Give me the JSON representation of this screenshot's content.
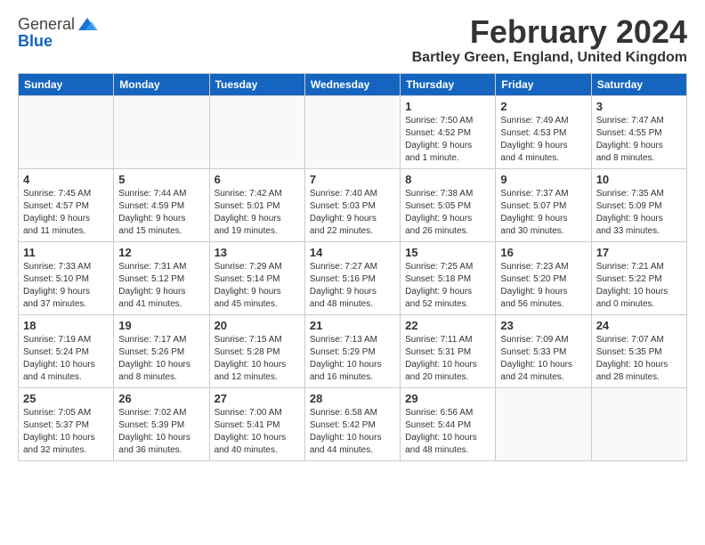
{
  "logo": {
    "general": "General",
    "blue": "Blue"
  },
  "header": {
    "month": "February 2024",
    "location": "Bartley Green, England, United Kingdom"
  },
  "weekdays": [
    "Sunday",
    "Monday",
    "Tuesday",
    "Wednesday",
    "Thursday",
    "Friday",
    "Saturday"
  ],
  "weeks": [
    [
      {
        "day": "",
        "info": ""
      },
      {
        "day": "",
        "info": ""
      },
      {
        "day": "",
        "info": ""
      },
      {
        "day": "",
        "info": ""
      },
      {
        "day": "1",
        "info": "Sunrise: 7:50 AM\nSunset: 4:52 PM\nDaylight: 9 hours\nand 1 minute."
      },
      {
        "day": "2",
        "info": "Sunrise: 7:49 AM\nSunset: 4:53 PM\nDaylight: 9 hours\nand 4 minutes."
      },
      {
        "day": "3",
        "info": "Sunrise: 7:47 AM\nSunset: 4:55 PM\nDaylight: 9 hours\nand 8 minutes."
      }
    ],
    [
      {
        "day": "4",
        "info": "Sunrise: 7:45 AM\nSunset: 4:57 PM\nDaylight: 9 hours\nand 11 minutes."
      },
      {
        "day": "5",
        "info": "Sunrise: 7:44 AM\nSunset: 4:59 PM\nDaylight: 9 hours\nand 15 minutes."
      },
      {
        "day": "6",
        "info": "Sunrise: 7:42 AM\nSunset: 5:01 PM\nDaylight: 9 hours\nand 19 minutes."
      },
      {
        "day": "7",
        "info": "Sunrise: 7:40 AM\nSunset: 5:03 PM\nDaylight: 9 hours\nand 22 minutes."
      },
      {
        "day": "8",
        "info": "Sunrise: 7:38 AM\nSunset: 5:05 PM\nDaylight: 9 hours\nand 26 minutes."
      },
      {
        "day": "9",
        "info": "Sunrise: 7:37 AM\nSunset: 5:07 PM\nDaylight: 9 hours\nand 30 minutes."
      },
      {
        "day": "10",
        "info": "Sunrise: 7:35 AM\nSunset: 5:09 PM\nDaylight: 9 hours\nand 33 minutes."
      }
    ],
    [
      {
        "day": "11",
        "info": "Sunrise: 7:33 AM\nSunset: 5:10 PM\nDaylight: 9 hours\nand 37 minutes."
      },
      {
        "day": "12",
        "info": "Sunrise: 7:31 AM\nSunset: 5:12 PM\nDaylight: 9 hours\nand 41 minutes."
      },
      {
        "day": "13",
        "info": "Sunrise: 7:29 AM\nSunset: 5:14 PM\nDaylight: 9 hours\nand 45 minutes."
      },
      {
        "day": "14",
        "info": "Sunrise: 7:27 AM\nSunset: 5:16 PM\nDaylight: 9 hours\nand 48 minutes."
      },
      {
        "day": "15",
        "info": "Sunrise: 7:25 AM\nSunset: 5:18 PM\nDaylight: 9 hours\nand 52 minutes."
      },
      {
        "day": "16",
        "info": "Sunrise: 7:23 AM\nSunset: 5:20 PM\nDaylight: 9 hours\nand 56 minutes."
      },
      {
        "day": "17",
        "info": "Sunrise: 7:21 AM\nSunset: 5:22 PM\nDaylight: 10 hours\nand 0 minutes."
      }
    ],
    [
      {
        "day": "18",
        "info": "Sunrise: 7:19 AM\nSunset: 5:24 PM\nDaylight: 10 hours\nand 4 minutes."
      },
      {
        "day": "19",
        "info": "Sunrise: 7:17 AM\nSunset: 5:26 PM\nDaylight: 10 hours\nand 8 minutes."
      },
      {
        "day": "20",
        "info": "Sunrise: 7:15 AM\nSunset: 5:28 PM\nDaylight: 10 hours\nand 12 minutes."
      },
      {
        "day": "21",
        "info": "Sunrise: 7:13 AM\nSunset: 5:29 PM\nDaylight: 10 hours\nand 16 minutes."
      },
      {
        "day": "22",
        "info": "Sunrise: 7:11 AM\nSunset: 5:31 PM\nDaylight: 10 hours\nand 20 minutes."
      },
      {
        "day": "23",
        "info": "Sunrise: 7:09 AM\nSunset: 5:33 PM\nDaylight: 10 hours\nand 24 minutes."
      },
      {
        "day": "24",
        "info": "Sunrise: 7:07 AM\nSunset: 5:35 PM\nDaylight: 10 hours\nand 28 minutes."
      }
    ],
    [
      {
        "day": "25",
        "info": "Sunrise: 7:05 AM\nSunset: 5:37 PM\nDaylight: 10 hours\nand 32 minutes."
      },
      {
        "day": "26",
        "info": "Sunrise: 7:02 AM\nSunset: 5:39 PM\nDaylight: 10 hours\nand 36 minutes."
      },
      {
        "day": "27",
        "info": "Sunrise: 7:00 AM\nSunset: 5:41 PM\nDaylight: 10 hours\nand 40 minutes."
      },
      {
        "day": "28",
        "info": "Sunrise: 6:58 AM\nSunset: 5:42 PM\nDaylight: 10 hours\nand 44 minutes."
      },
      {
        "day": "29",
        "info": "Sunrise: 6:56 AM\nSunset: 5:44 PM\nDaylight: 10 hours\nand 48 minutes."
      },
      {
        "day": "",
        "info": ""
      },
      {
        "day": "",
        "info": ""
      }
    ]
  ]
}
